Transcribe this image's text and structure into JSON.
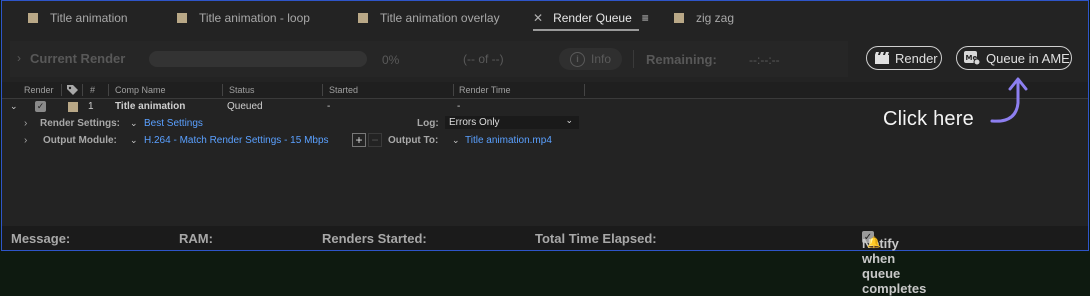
{
  "tabs": [
    {
      "label": "Title animation"
    },
    {
      "label": "Title animation - loop"
    },
    {
      "label": "Title animation overlay"
    },
    {
      "label": "Render Queue"
    },
    {
      "label": "zig zag"
    }
  ],
  "current_render": {
    "label": "Current Render",
    "percent": "0%",
    "of": "(-- of --)",
    "info": "Info",
    "remaining_label": "Remaining:",
    "remaining_value": "--:--:--"
  },
  "buttons": {
    "render": "Render",
    "queue_ame": "Queue in AME"
  },
  "columns": {
    "render": "Render",
    "num": "#",
    "comp_name": "Comp Name",
    "status": "Status",
    "started": "Started",
    "render_time": "Render Time"
  },
  "item": {
    "number": "1",
    "comp_name": "Title animation",
    "status": "Queued",
    "started": "-",
    "render_time": "-"
  },
  "render_settings": {
    "label": "Render Settings:",
    "value": "Best Settings",
    "log_label": "Log:",
    "log_value": "Errors Only"
  },
  "output": {
    "label": "Output Module:",
    "value": "H.264 - Match Render Settings - 15 Mbps",
    "to_label": "Output To:",
    "to_value": "Title animation.mp4"
  },
  "annotation": "Click here",
  "footer": {
    "message": "Message:",
    "ram": "RAM:",
    "renders_started": "Renders Started:",
    "total_time": "Total Time Elapsed:",
    "notify": "Notify when queue completes"
  },
  "colors": {
    "accent_blue": "#5aa0ff",
    "label_swatch": "#b9a887",
    "panel_border": "#2e55c9"
  },
  "icons": [
    "close-icon",
    "panel-menu-icon",
    "chevron-right-icon",
    "info-icon",
    "render-icon",
    "media-encoder-icon",
    "tag-icon",
    "chevron-down-icon",
    "checkbox-icon",
    "bell-icon"
  ]
}
